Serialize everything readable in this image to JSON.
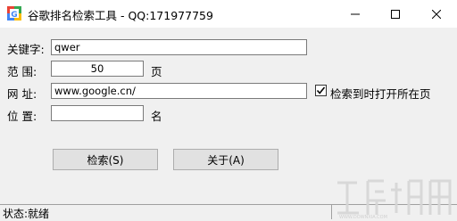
{
  "window": {
    "title": "谷歌排名检索工具 - QQ:171977759"
  },
  "form": {
    "keyword_label": "关键字:",
    "keyword_value": "qwer",
    "range_label": "范  围:",
    "range_value": "50",
    "range_unit": "页",
    "url_label": "网  址:",
    "url_value": "www.google.cn/",
    "open_page_checkbox_label": "检索到时打开所在页",
    "open_page_checked": true,
    "position_label": "位  置:",
    "position_value": "",
    "position_unit": "名"
  },
  "buttons": {
    "search_label": "检索(S)",
    "about_label": "关于(A)"
  },
  "status": {
    "text": "状态:就绪"
  }
}
